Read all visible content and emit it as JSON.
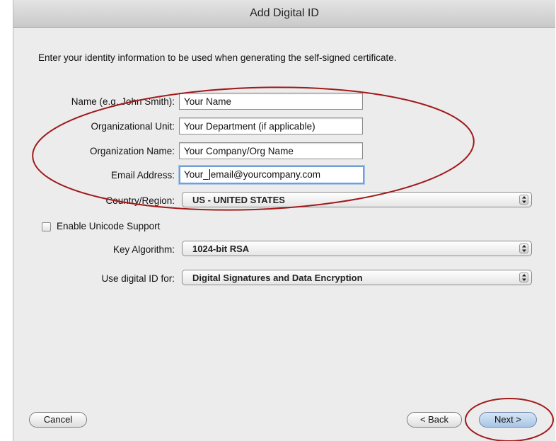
{
  "window": {
    "title": "Add Digital ID"
  },
  "intro": "Enter your identity information to be used when generating the self-signed certificate.",
  "fields": {
    "name": {
      "label": "Name (e.g. John Smith):",
      "value": "Your Name"
    },
    "org_unit": {
      "label": "Organizational Unit:",
      "value": "Your Department (if applicable)"
    },
    "org_name": {
      "label": "Organization Name:",
      "value": "Your Company/Org Name"
    },
    "email": {
      "label": "Email Address:",
      "value_before_caret": "Your_",
      "value_after_caret": "email@yourcompany.com"
    }
  },
  "country": {
    "label": "Country/Region:",
    "value": "US - UNITED STATES"
  },
  "unicode": {
    "label": "Enable Unicode Support",
    "checked": false
  },
  "key_algorithm": {
    "label": "Key Algorithm:",
    "value": "1024-bit RSA"
  },
  "use_for": {
    "label": "Use digital ID for:",
    "value": "Digital Signatures and Data Encryption"
  },
  "buttons": {
    "cancel": "Cancel",
    "back": "< Back",
    "next": "Next >"
  },
  "colors": {
    "annotation": "#a11a1a",
    "focus_ring": "#6f9ed8",
    "window_bg": "#ececec"
  }
}
